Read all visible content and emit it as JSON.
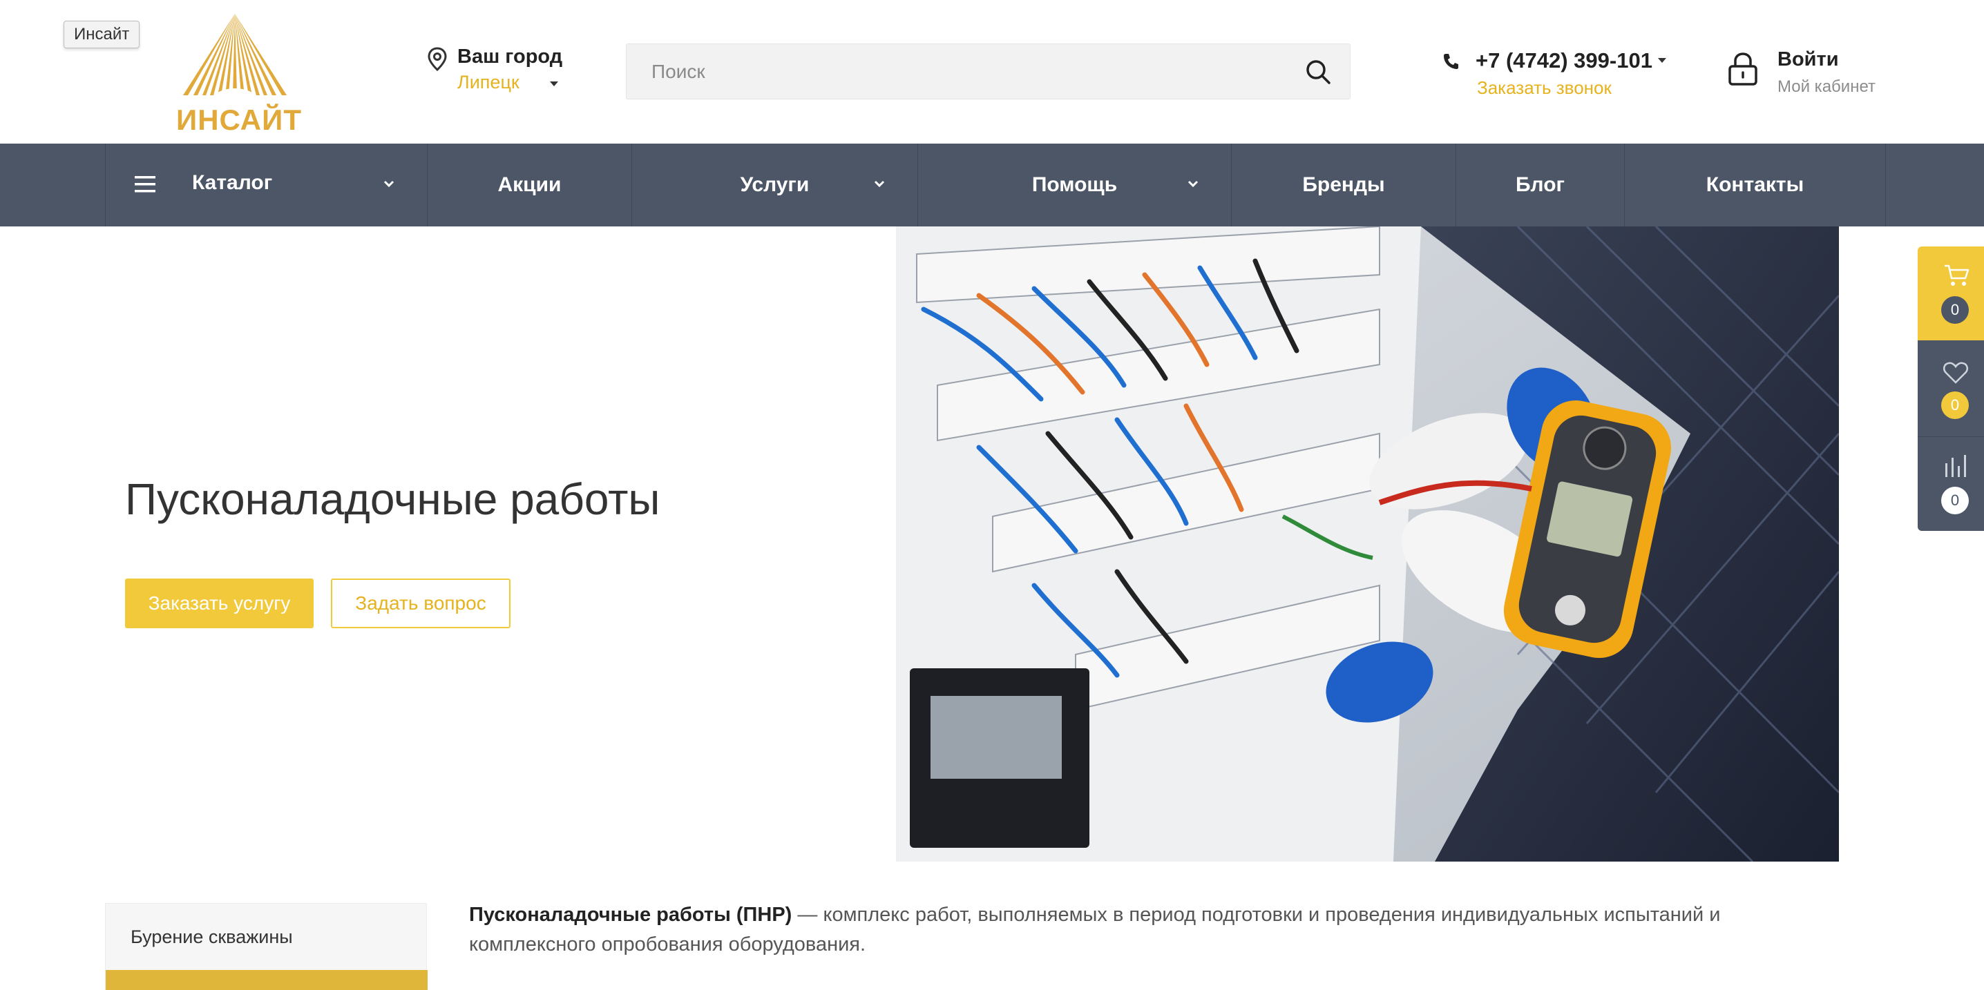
{
  "tooltip": "Инсайт",
  "logo": {
    "text": "ИНСАЙТ"
  },
  "city": {
    "title": "Ваш город",
    "name": "Липецк"
  },
  "search": {
    "placeholder": "Поиск"
  },
  "phone": {
    "number": "+7 (4742) 399-101",
    "callback": "Заказать звонок"
  },
  "account": {
    "title": "Войти",
    "subtitle": "Мой кабинет"
  },
  "nav": {
    "items": [
      {
        "label": "Каталог"
      },
      {
        "label": "Акции"
      },
      {
        "label": "Услуги"
      },
      {
        "label": "Помощь"
      },
      {
        "label": "Бренды"
      },
      {
        "label": "Блог"
      },
      {
        "label": "Контакты"
      }
    ]
  },
  "hero": {
    "title": "Пусконаладочные работы",
    "order_button": "Заказать услугу",
    "ask_button": "Задать вопрос"
  },
  "side_panel": {
    "cart_count": "0",
    "favorites_count": "0",
    "compare_count": "0"
  },
  "sidebar": {
    "items": [
      {
        "label": "Бурение скважины"
      }
    ]
  },
  "description": {
    "bold": "Пусконаладочные работы (ПНР)",
    "text": " — комплекс работ, выполняемых в период подготовки и проведения индивидуальных испытаний и комплексного опробования оборудования."
  },
  "colors": {
    "accent": "#f2c93a",
    "nav_bg": "#4c5667",
    "logo_gold": "#e0a93a"
  }
}
